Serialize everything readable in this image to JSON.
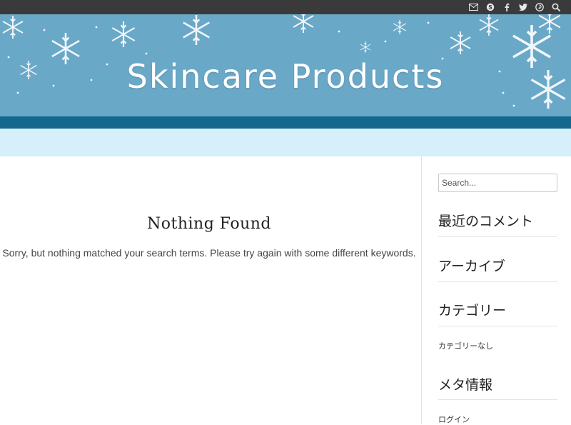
{
  "top_bar": {
    "icons": [
      "envelope-icon",
      "skype-icon",
      "facebook-icon",
      "twitter-icon",
      "pinterest-icon",
      "search-icon"
    ]
  },
  "header": {
    "site_title": "Skincare Products"
  },
  "main": {
    "heading": "Nothing Found",
    "message": "Sorry, but nothing matched your search terms. Please try again with some different keywords."
  },
  "sidebar": {
    "search_placeholder": "Search...",
    "widgets": {
      "recent_comments": "最近のコメント",
      "archives": "アーカイブ",
      "categories": "カテゴリー",
      "categories_item": "カテゴリーなし",
      "meta": "メタ情報",
      "meta_item": "ログイン"
    }
  },
  "colors": {
    "top_bar": "#3a3a3a",
    "banner": "#6aa8c8",
    "nav_bar": "#14688e",
    "sub_nav": "#d6f0fb"
  }
}
